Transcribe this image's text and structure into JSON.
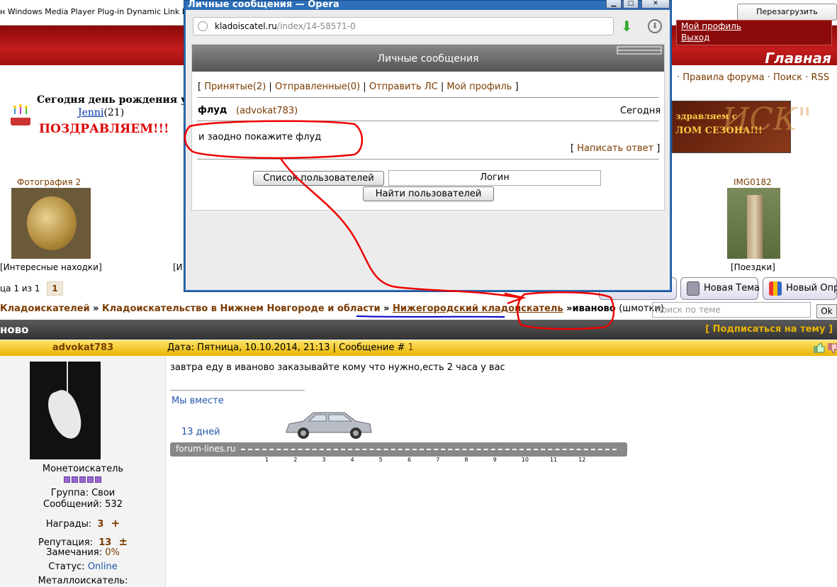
{
  "browser_bar": {
    "plugin_text": "н Windows Media Player Plug-in Dynamic Link Library r",
    "reload_label": "Перезагрузить страницу"
  },
  "header": {
    "profile_link": "Мой профиль",
    "logout_link": "Выход",
    "home_label": "Главная",
    "nav_links": "· Правила форума · Поиск · RSS"
  },
  "birthday": {
    "title": "Сегодня день рождения у:",
    "user": "Jenni",
    "age": "(21)",
    "congrats": "ПОЗДРАВЛЯЕМ!!!"
  },
  "banner": {
    "line1": "здравляем с",
    "line2": "ЛОМ СЕЗОНА!!!",
    "big": "ИСК\""
  },
  "photos": [
    {
      "caption": "Фотография 2",
      "category": "[Интересные находки]"
    },
    {
      "caption": "IMG0182",
      "category": "[Поездки]"
    }
  ],
  "photo_partial": "[И",
  "pager": {
    "text": "ца 1 из 1",
    "current": "1"
  },
  "tools": {
    "new_topic": "Новая Тема",
    "new_poll": "Новый Опрос"
  },
  "breadcrumb": {
    "item1": "Кладоискателей",
    "sep": "»",
    "item2": "Кладоискательство в Нижнем Новгороде и области",
    "item3": "Нижегородский кладоискатель",
    "sep2": "»",
    "topic": "иваново",
    "sub": "(шмотки)"
  },
  "search": {
    "placeholder": "Поиск по теме",
    "ok": "Ok"
  },
  "topic_bar": {
    "title": "ново",
    "subscribe": "[ Подписаться на тему ]"
  },
  "post": {
    "author": "advokat783",
    "meta_date": "Дата: Пятница, 10.10.2014, 21:13 | Сообщение #",
    "meta_num": "1",
    "rank": "Монетоискатель",
    "group": "Группа: Свои",
    "messages": "Сообщений: 532",
    "awards_label": "Награды:",
    "awards_val": "3",
    "rep_label": "Репутация:",
    "rep_val": "13",
    "remarks_label": "Замечания:",
    "remarks_val": "0%",
    "status_label": "Статус:",
    "status_val": "Online",
    "detector": "Металлоискатель:",
    "text": "завтра еду в иваново заказывайте кому что нужно,есть 2 часа у вас",
    "sig_together": "Мы вместе",
    "sig_days": "13 дней",
    "sig_site": "forum-lines.ru",
    "sig_ticks": [
      "1",
      "2",
      "3",
      "4",
      "5",
      "6",
      "7",
      "8",
      "9",
      "10",
      "11",
      "12"
    ]
  },
  "popup": {
    "window_title": "Личные сообщения — Opera",
    "url_host": "kladoiscatel.ru",
    "url_path": "/index/14-58571-0",
    "header": "Личные сообщения",
    "nav": {
      "open": "[",
      "received": "Принятые",
      "received_count": "(2)",
      "sent": "Отправленные",
      "sent_count": "(0)",
      "send": "Отправить ЛС",
      "profile": "Мой профиль",
      "close": "]",
      "sep": "|"
    },
    "subject": "флуд",
    "from": "(advokat783)",
    "date": "Сегодня",
    "text": "и заодно покажите флуд",
    "reply": "Написать ответ",
    "users_list_btn": "Список пользователей",
    "login_value": "Логин",
    "find_users_btn": "Найти пользователей"
  },
  "colors": {
    "accent": "#7a3b00",
    "header_red": "#b01515",
    "post_head": "#f0c000",
    "annotation": "#e00000"
  }
}
